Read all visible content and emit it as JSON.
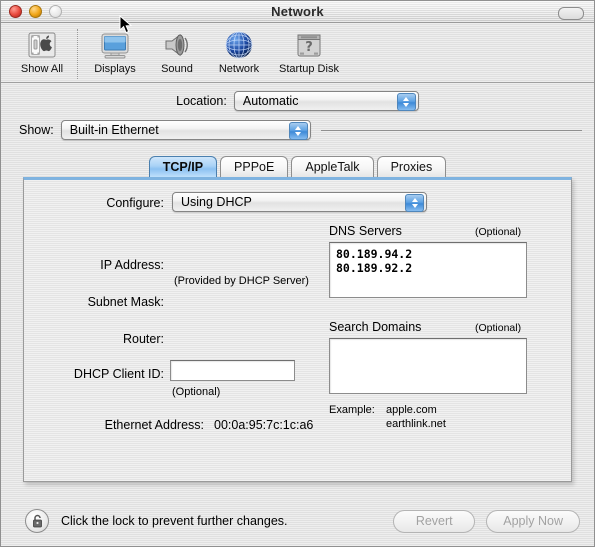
{
  "window": {
    "title": "Network",
    "close_label": "close",
    "minimize_label": "minimize",
    "zoom_label": "zoom",
    "toolbar_toggle_label": "toggle-toolbar"
  },
  "toolbar": {
    "items": [
      {
        "label": "Show All",
        "icon": "show-all-icon"
      },
      {
        "label": "Displays",
        "icon": "displays-icon"
      },
      {
        "label": "Sound",
        "icon": "sound-icon"
      },
      {
        "label": "Network",
        "icon": "network-globe-icon"
      },
      {
        "label": "Startup Disk",
        "icon": "startup-disk-icon"
      }
    ]
  },
  "location": {
    "label": "Location:",
    "value": "Automatic"
  },
  "show": {
    "label": "Show:",
    "value": "Built-in Ethernet"
  },
  "tabs": [
    {
      "label": "TCP/IP",
      "active": true
    },
    {
      "label": "PPPoE",
      "active": false
    },
    {
      "label": "AppleTalk",
      "active": false
    },
    {
      "label": "Proxies",
      "active": false
    }
  ],
  "tcpip": {
    "configure_label": "Configure:",
    "configure_value": "Using DHCP",
    "ip_address_label": "IP Address:",
    "ip_address_value": "",
    "ip_address_note": "(Provided by DHCP Server)",
    "subnet_mask_label": "Subnet Mask:",
    "subnet_mask_value": "",
    "router_label": "Router:",
    "router_value": "",
    "dhcp_client_id_label": "DHCP Client ID:",
    "dhcp_client_id_value": "",
    "dhcp_client_id_note": "(Optional)",
    "ethernet_address_label": "Ethernet Address:",
    "ethernet_address_value": "00:0a:95:7c:1c:a6",
    "dns_servers_label": "DNS Servers",
    "dns_servers_optional": "(Optional)",
    "dns_servers_value": "80.189.94.2\n80.189.92.2",
    "search_domains_label": "Search Domains",
    "search_domains_optional": "(Optional)",
    "search_domains_value": "",
    "example_label": "Example:",
    "example_line1": "apple.com",
    "example_line2": "earthlink.net"
  },
  "footer": {
    "lock_icon": "open-padlock-icon",
    "lock_text": "Click the lock to prevent further changes.",
    "revert_label": "Revert",
    "apply_label": "Apply Now"
  },
  "colors": {
    "accent_blue": "#8cc1f1",
    "panel_border_top": "#7fb3e0",
    "disabled_text": "#a2a2a2"
  }
}
